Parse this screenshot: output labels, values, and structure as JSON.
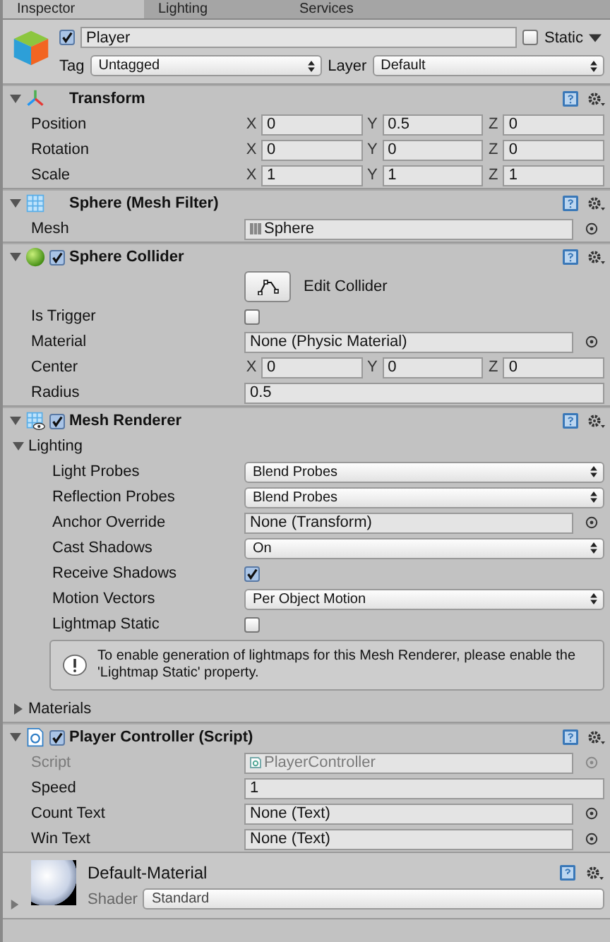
{
  "tabs": [
    {
      "label": "Inspector",
      "selected": true
    },
    {
      "label": "Lighting",
      "selected": false
    },
    {
      "label": "Services",
      "selected": false
    }
  ],
  "object": {
    "active": true,
    "name": "Player",
    "static_label": "Static",
    "static": false,
    "tag_label": "Tag",
    "tag": "Untagged",
    "layer_label": "Layer",
    "layer": "Default"
  },
  "components": [
    {
      "kind": "transform",
      "title": "Transform",
      "expanded": true,
      "rows": [
        {
          "kind": "vector3",
          "label": "Position",
          "values": [
            {
              "axis": "X",
              "value": "0"
            },
            {
              "axis": "Y",
              "value": "0.5"
            },
            {
              "axis": "Z",
              "value": "0"
            }
          ]
        },
        {
          "kind": "vector3",
          "label": "Rotation",
          "values": [
            {
              "axis": "X",
              "value": "0"
            },
            {
              "axis": "Y",
              "value": "0"
            },
            {
              "axis": "Z",
              "value": "0"
            }
          ]
        },
        {
          "kind": "vector3",
          "label": "Scale",
          "values": [
            {
              "axis": "X",
              "value": "1"
            },
            {
              "axis": "Y",
              "value": "1"
            },
            {
              "axis": "Z",
              "value": "1"
            }
          ]
        }
      ]
    },
    {
      "kind": "meshfilter",
      "title": "Sphere (Mesh Filter)",
      "expanded": true,
      "rows": [
        {
          "kind": "mesh_object",
          "label": "Mesh",
          "value": "Sphere"
        }
      ]
    },
    {
      "kind": "collider",
      "title": "Sphere Collider",
      "expanded": true,
      "enabled": true,
      "rows": [
        {
          "kind": "button",
          "text": "Edit Collider"
        },
        {
          "kind": "checkbox",
          "label": "Is Trigger",
          "checked": false
        },
        {
          "kind": "object",
          "label": "Material",
          "value": "None (Physic Material)"
        },
        {
          "kind": "vector3",
          "label": "Center",
          "values": [
            {
              "axis": "X",
              "value": "0"
            },
            {
              "axis": "Y",
              "value": "0"
            },
            {
              "axis": "Z",
              "value": "0"
            }
          ]
        },
        {
          "kind": "text",
          "label": "Radius",
          "value": "0.5"
        }
      ]
    },
    {
      "kind": "renderer",
      "title": "Mesh Renderer",
      "expanded": true,
      "enabled": true,
      "rows": [
        {
          "kind": "foldout",
          "label": "Lighting",
          "expanded": true,
          "children": [
            {
              "kind": "dropdown",
              "label": "Light Probes",
              "value": "Blend Probes"
            },
            {
              "kind": "dropdown",
              "label": "Reflection Probes",
              "value": "Blend Probes"
            },
            {
              "kind": "object",
              "label": "Anchor Override",
              "value": "None (Transform)"
            },
            {
              "kind": "dropdown",
              "label": "Cast Shadows",
              "value": "On"
            },
            {
              "kind": "checkbox",
              "label": "Receive Shadows",
              "checked": true
            },
            {
              "kind": "dropdown",
              "label": "Motion Vectors",
              "value": "Per Object Motion"
            },
            {
              "kind": "checkbox",
              "label": "Lightmap Static",
              "checked": false
            },
            {
              "kind": "helpbox",
              "text": "To enable generation of lightmaps for this Mesh Renderer, please enable the 'Lightmap Static' property."
            }
          ]
        },
        {
          "kind": "foldout",
          "label": "Materials",
          "expanded": false
        }
      ]
    },
    {
      "kind": "script",
      "title": "Player Controller (Script)",
      "expanded": true,
      "enabled": true,
      "rows": [
        {
          "kind": "script_object",
          "label": "Script",
          "value": "PlayerController",
          "disabled": true
        },
        {
          "kind": "text",
          "label": "Speed",
          "value": "1",
          "disabled": false
        },
        {
          "kind": "object",
          "label": "Count Text",
          "value": "None (Text)",
          "disabled": false
        },
        {
          "kind": "object",
          "label": "Win Text",
          "value": "None (Text)",
          "disabled": false
        }
      ]
    }
  ],
  "material": {
    "name": "Default-Material",
    "shader_label": "Shader",
    "shader": "Standard",
    "expanded": false
  }
}
